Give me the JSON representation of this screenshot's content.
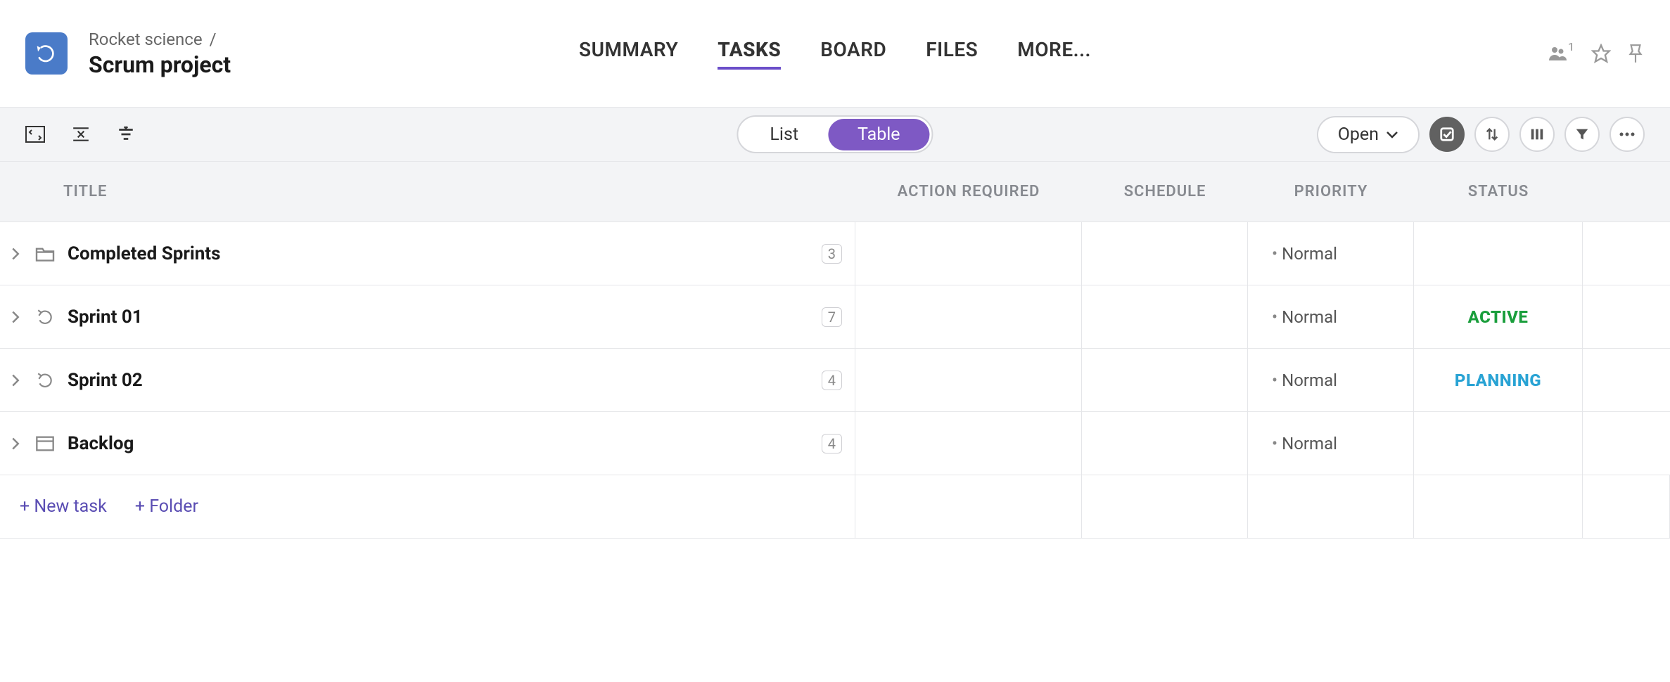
{
  "breadcrumb": {
    "parent": "Rocket science",
    "sep": "/"
  },
  "project": {
    "name": "Scrum project"
  },
  "tabs": [
    "SUMMARY",
    "TASKS",
    "BOARD",
    "FILES",
    "MORE..."
  ],
  "active_tab": 1,
  "share_count": "1",
  "view_toggle": {
    "list": "List",
    "table": "Table",
    "active": "table"
  },
  "filter_dropdown": {
    "label": "Open"
  },
  "columns": {
    "title": "TITLE",
    "action": "ACTION REQUIRED",
    "schedule": "SCHEDULE",
    "priority": "PRIORITY",
    "status": "STATUS"
  },
  "rows": [
    {
      "icon": "folder",
      "name": "Completed Sprints",
      "count": "3",
      "priority": "Normal",
      "status": ""
    },
    {
      "icon": "sprint",
      "name": "Sprint 01",
      "count": "7",
      "priority": "Normal",
      "status": "ACTIVE",
      "status_class": "status-active"
    },
    {
      "icon": "sprint",
      "name": "Sprint 02",
      "count": "4",
      "priority": "Normal",
      "status": "PLANNING",
      "status_class": "status-planning"
    },
    {
      "icon": "box",
      "name": "Backlog",
      "count": "4",
      "priority": "Normal",
      "status": ""
    }
  ],
  "footer": {
    "new_task": "+ New task",
    "new_folder": "+ Folder"
  }
}
